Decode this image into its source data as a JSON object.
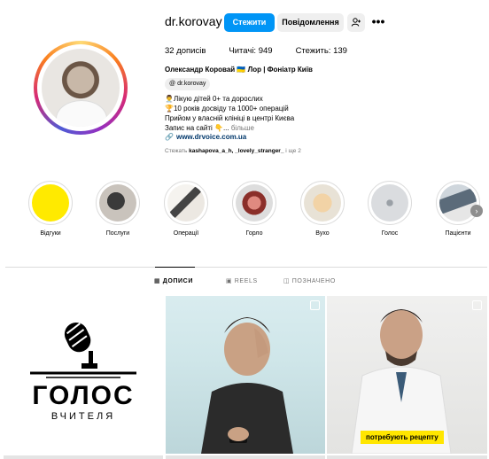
{
  "profile": {
    "username": "dr.korovay",
    "follow_label": "Стежити",
    "message_label": "Повідомлення",
    "add_person_symbol": "+",
    "more_symbol": "•••",
    "stats": {
      "posts": "32 дописів",
      "followers": "Читачі: 949",
      "following": "Стежить: 139"
    },
    "full_name": "Олександр Коровай 🇺🇦 Лор | Фоніатр Київ",
    "threads_handle": "dr.korovay",
    "bio_lines": [
      "👨‍⚕️Лікую дітей 0+ та дорослих",
      "🏆10 років досвіду та 1000+ операцій",
      "Прийом у власній клініці в центрі Києва",
      "Запис на сайті 👇..."
    ],
    "bio_more": "більше",
    "link_text": "www.drvoice.com.ua",
    "followed_by_prefix": "Стежать",
    "followed_by_names": "kashapova_a_h, _lovely_stranger_",
    "followed_by_suffix": "і ще 2"
  },
  "highlights": [
    {
      "label": "Відгуки",
      "color": "#ffea00"
    },
    {
      "label": "Послуги",
      "color": "#b9b3ad"
    },
    {
      "label": "Операції",
      "color": "#e8e4de"
    },
    {
      "label": "Горло",
      "color": "#c4524a"
    },
    {
      "label": "Вухо",
      "color": "#e8c99a"
    },
    {
      "label": "Голос",
      "color": "#d9dadb"
    },
    {
      "label": "Пацієнти",
      "color": "#9aa7b2"
    }
  ],
  "highlight_next_symbol": "›",
  "tabs": [
    {
      "label": "ДОПИСИ",
      "icon": "grid-icon",
      "active": true
    },
    {
      "label": "REELS",
      "icon": "reels-icon",
      "active": false
    },
    {
      "label": "ПОЗНАЧЕНО",
      "icon": "tagged-icon",
      "active": false
    }
  ],
  "posts": [
    {
      "title": "ГОЛОС",
      "subtitle": "ВЧИТЕЛЯ"
    },
    {
      "caption": ""
    },
    {
      "caption": "потребують рецепту"
    }
  ],
  "colors": {
    "accent": "#0095f6",
    "highlight_yellow": "#ffea00",
    "badge_yellow": "#ffe600"
  }
}
